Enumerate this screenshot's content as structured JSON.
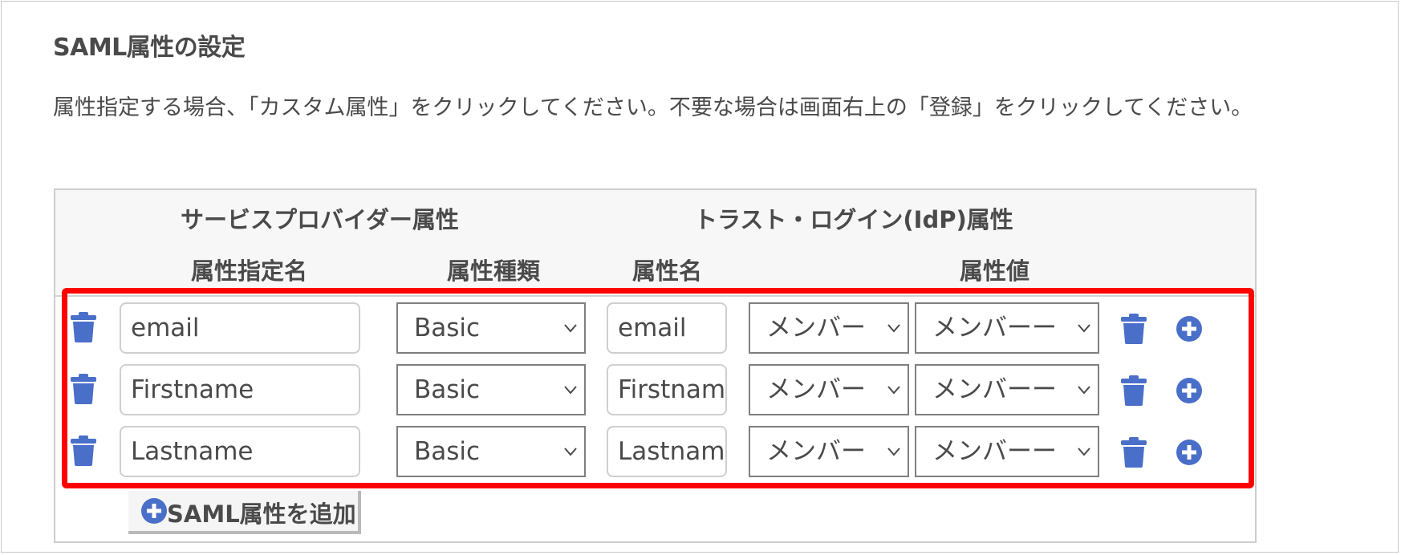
{
  "section": {
    "title": "SAML属性の設定",
    "description": "属性指定する場合、「カスタム属性」をクリックしてください。不要な場合は画面右上の「登録」をクリックしてください。"
  },
  "table": {
    "group_headers": {
      "sp": "サービスプロバイダー属性",
      "idp": "トラスト・ログイン(IdP)属性"
    },
    "column_headers": {
      "name": "属性指定名",
      "type": "属性種類",
      "attr_name": "属性名",
      "attr_value": "属性値"
    },
    "rows": [
      {
        "name": "email",
        "type": "Basic",
        "attr_name": "email",
        "value1": "メンバー",
        "value2": "メンバーー"
      },
      {
        "name": "Firstname",
        "type": "Basic",
        "attr_name": "Firstnam",
        "value1": "メンバー",
        "value2": "メンバーー"
      },
      {
        "name": "Lastname",
        "type": "Basic",
        "attr_name": "Lastnam",
        "value1": "メンバー",
        "value2": "メンバーー"
      }
    ],
    "add_button_label": "SAML属性を追加"
  },
  "icons": {
    "delete": "trash-icon",
    "add": "plus-circle-icon",
    "dropdown": "chevron-down-icon"
  },
  "colors": {
    "icon_blue": "#4a6fc9",
    "highlight_red": "#ff0000"
  }
}
